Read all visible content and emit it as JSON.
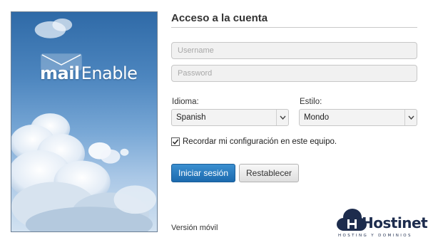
{
  "brand_panel": {
    "logo_mail": "mail",
    "logo_enable": "Enable"
  },
  "login": {
    "title": "Acceso a la cuenta",
    "username": {
      "placeholder": "Username",
      "value": ""
    },
    "password": {
      "placeholder": "Password",
      "value": ""
    },
    "language": {
      "label": "Idioma:",
      "selected": "Spanish"
    },
    "style": {
      "label": "Estilo:",
      "selected": "Mondo"
    },
    "remember": {
      "label": "Recordar mi configuración en este equipo.",
      "checked": true
    },
    "buttons": {
      "login": "Iniciar sesión",
      "reset": "Restablecer"
    },
    "mobile_link": "Versión móvil"
  },
  "watermark": {
    "name": "Hostinet",
    "tagline": "HOSTING Y DOMINIOS"
  },
  "colors": {
    "primary_button": "#1c6aae",
    "sky": "#4d86bf",
    "brand": "#1d2c4d"
  },
  "icons": [
    "envelope-icon",
    "chevron-down-icon",
    "checkmark-icon",
    "cloud-logo-icon"
  ]
}
